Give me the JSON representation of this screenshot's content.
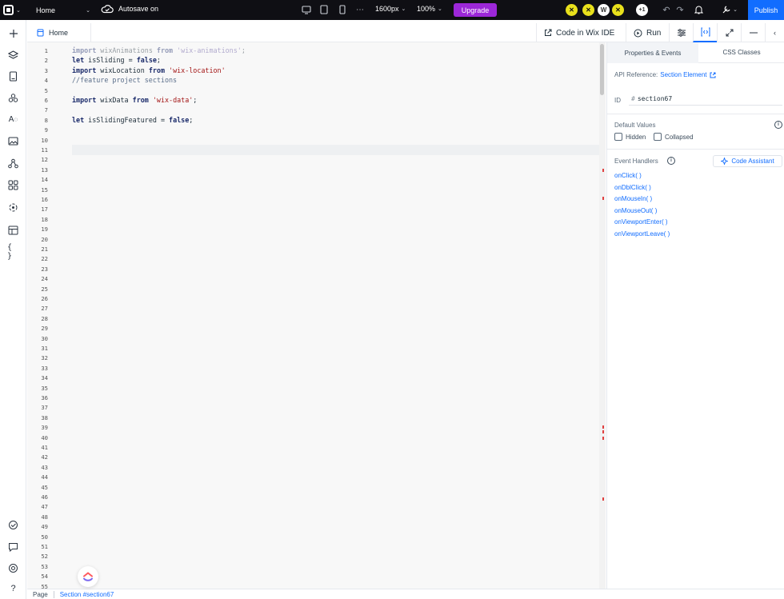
{
  "topbar": {
    "page_name": "Home",
    "autosave": "Autosave on",
    "width_value": "1600px",
    "zoom_value": "100%",
    "upgrade_label": "Upgrade",
    "publish_label": "Publish",
    "collaborators": [
      {
        "initial": "",
        "color": "#e8e01c"
      },
      {
        "initial": "",
        "color": "#e8e01c"
      },
      {
        "initial": "W",
        "color": "#ffffff"
      },
      {
        "initial": "",
        "color": "#e8e01c"
      },
      {
        "initial": "+1",
        "color": "#ffffff"
      }
    ]
  },
  "editor": {
    "file_tab": "Home",
    "code_in_ide_label": "Code in Wix IDE",
    "run_label": "Run",
    "lines": [
      [
        [
          "kw",
          "import"
        ],
        [
          "t",
          " wixAnimations "
        ],
        [
          "kw",
          "from"
        ],
        [
          "t",
          " "
        ],
        [
          "str2",
          "'wix-animations'"
        ],
        [
          "t",
          ";"
        ]
      ],
      [
        [
          "kw",
          "let"
        ],
        [
          "t",
          " isSliding = "
        ],
        [
          "kw",
          "false"
        ],
        [
          "t",
          ";"
        ]
      ],
      [
        [
          "kw",
          "import"
        ],
        [
          "t",
          " wixLocation "
        ],
        [
          "kw",
          "from"
        ],
        [
          "t",
          " "
        ],
        [
          "str",
          "'wix-location'"
        ]
      ],
      [
        [
          "cmt",
          "//feature project sections"
        ]
      ],
      [],
      [
        [
          "kw",
          "import"
        ],
        [
          "t",
          " wixData "
        ],
        [
          "kw",
          "from"
        ],
        [
          "t",
          " "
        ],
        [
          "str",
          "'wix-data'"
        ],
        [
          "t",
          ";"
        ]
      ],
      [],
      [
        [
          "kw",
          "let"
        ],
        [
          "t",
          " isSlidingFeatured = "
        ],
        [
          "kw",
          "false"
        ],
        [
          "t",
          ";"
        ]
      ]
    ],
    "line_count": 55
  },
  "panel": {
    "tab_properties": "Properties & Events",
    "tab_css": "CSS Classes",
    "api_ref_label": "API Reference:",
    "api_ref_link": "Section Element",
    "id_label": "ID",
    "id_hash": "#",
    "id_value": "section67",
    "default_values_title": "Default Values",
    "hidden_label": "Hidden",
    "collapsed_label": "Collapsed",
    "event_handlers_title": "Event Handlers",
    "code_assistant_label": "Code Assistant",
    "handlers": [
      "onClick( )",
      "onDblClick( )",
      "onMouseIn( )",
      "onMouseOut( )",
      "onViewportEnter( )",
      "onViewportLeave( )"
    ]
  },
  "statusbar": {
    "page_label": "Page",
    "section_label": "Section #section67"
  },
  "colors": {
    "accent": "#116dff",
    "upgrade": "#9c27d9",
    "topbar_bg": "#0f0f14"
  }
}
